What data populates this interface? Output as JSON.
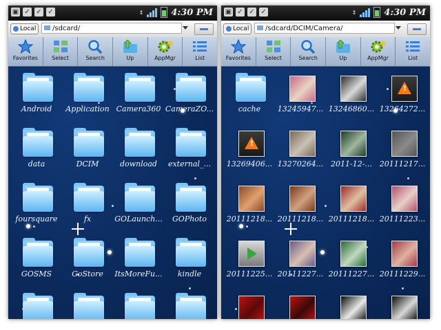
{
  "panels": [
    {
      "status": {
        "time": "4:30 PM"
      },
      "local_label": "Local",
      "path": "/sdcard/",
      "toolbar": [
        "Favorites",
        "Select",
        "Search",
        "Up",
        "AppMgr",
        "List"
      ],
      "items": [
        {
          "label": "Android",
          "type": "folder"
        },
        {
          "label": "Application",
          "type": "folder"
        },
        {
          "label": "Camera360",
          "type": "folder"
        },
        {
          "label": "CameraZO...",
          "type": "folder"
        },
        {
          "label": "data",
          "type": "folder"
        },
        {
          "label": "DCIM",
          "type": "folder"
        },
        {
          "label": "download",
          "type": "folder"
        },
        {
          "label": "external_...",
          "type": "folder"
        },
        {
          "label": "foursquare",
          "type": "folder"
        },
        {
          "label": "fx",
          "type": "folder"
        },
        {
          "label": "GOLaunch...",
          "type": "folder"
        },
        {
          "label": "GOPhoto",
          "type": "folder"
        },
        {
          "label": "GOSMS",
          "type": "folder"
        },
        {
          "label": "GoStore",
          "type": "folder"
        },
        {
          "label": "ItsMoreFu...",
          "type": "folder"
        },
        {
          "label": "kindle",
          "type": "folder"
        },
        {
          "label": "",
          "type": "folder"
        },
        {
          "label": "",
          "type": "folder"
        },
        {
          "label": "",
          "type": "folder"
        },
        {
          "label": "",
          "type": "folder"
        }
      ]
    },
    {
      "status": {
        "time": "4:30 PM"
      },
      "local_label": "Local",
      "path": "/sdcard/DCIM/Camera/",
      "toolbar": [
        "Favorites",
        "Select",
        "Search",
        "Up",
        "AppMgr",
        "List"
      ],
      "items": [
        {
          "label": "cache",
          "type": "folder"
        },
        {
          "label": "13245947...",
          "type": "photo",
          "colors": [
            "#c46a8a",
            "#e9d3c2"
          ]
        },
        {
          "label": "13246860...",
          "type": "photo",
          "colors": [
            "#2e2e2e",
            "#d9d9d9"
          ]
        },
        {
          "label": "13264272...",
          "type": "warning"
        },
        {
          "label": "13269406...",
          "type": "warning"
        },
        {
          "label": "13270264...",
          "type": "photo",
          "colors": [
            "#7a6a5a",
            "#c9c1b4"
          ]
        },
        {
          "label": "2011-12-...",
          "type": "photo",
          "colors": [
            "#1f3c2a",
            "#9fb6a0"
          ]
        },
        {
          "label": "20111217...",
          "type": "photo",
          "colors": [
            "#555555",
            "#8a8a8a"
          ]
        },
        {
          "label": "20111218...",
          "type": "photo",
          "colors": [
            "#8a4a2a",
            "#e0a070"
          ]
        },
        {
          "label": "20111218...",
          "type": "photo",
          "colors": [
            "#7a3a1a",
            "#d0a080"
          ]
        },
        {
          "label": "20111218...",
          "type": "photo",
          "colors": [
            "#9a2a2a",
            "#e0c0a0"
          ]
        },
        {
          "label": "20111223...",
          "type": "photo",
          "colors": [
            "#b05070",
            "#e8d0c8"
          ]
        },
        {
          "label": "20111225...",
          "type": "video"
        },
        {
          "label": "20111227...",
          "type": "photo",
          "colors": [
            "#6a5a8a",
            "#d8c0b0"
          ]
        },
        {
          "label": "20111227...",
          "type": "photo",
          "colors": [
            "#2a6a3a",
            "#c0d8c0"
          ]
        },
        {
          "label": "20111229...",
          "type": "photo",
          "colors": [
            "#a03a4a",
            "#e0b0a0"
          ]
        },
        {
          "label": "",
          "type": "photo",
          "colors": [
            "#c01010",
            "#5a0a0a"
          ]
        },
        {
          "label": "",
          "type": "photo",
          "colors": [
            "#c01010",
            "#3a0a0a"
          ]
        },
        {
          "label": "",
          "type": "photo",
          "colors": [
            "#0a0a0a",
            "#e8e8e8"
          ]
        },
        {
          "label": "",
          "type": "photo",
          "colors": [
            "#0a0a0a",
            "#d8d8d8"
          ]
        }
      ]
    }
  ]
}
